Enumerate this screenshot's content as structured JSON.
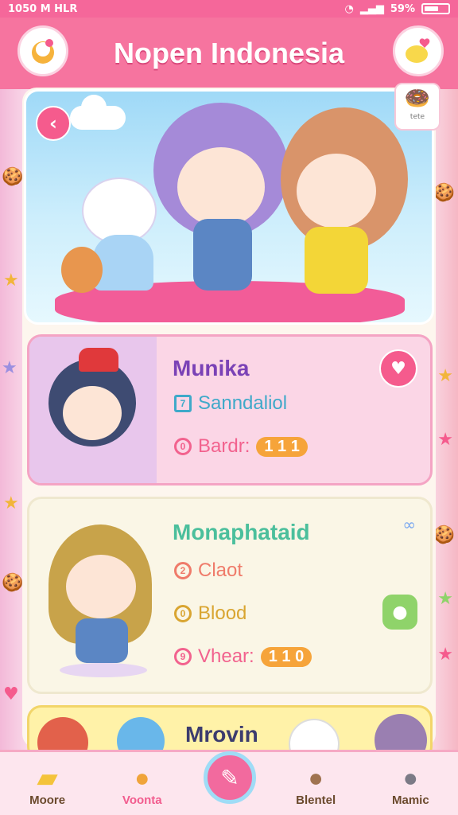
{
  "status_bar": {
    "time": "1050 M HLR",
    "battery": "59%"
  },
  "header": {
    "title": "Nopen Indonesia",
    "left_icon": "mascot-logo-icon",
    "right_icon": "chat-heart-icon"
  },
  "hero": {
    "back_icon": "chevron-left-icon",
    "badge_label": "tete"
  },
  "cards": [
    {
      "name": "Munika",
      "rows": [
        {
          "icon": "7",
          "label": "Sanndaliol",
          "color": "#3fa9c9"
        },
        {
          "icon": "0",
          "label": "Bardr:",
          "value": "1 1 1",
          "color": "#f2628e"
        }
      ]
    },
    {
      "name": "Monaphataid",
      "rows": [
        {
          "icon": "2",
          "label": "Claot",
          "color": "#ef7b6a"
        },
        {
          "icon": "0",
          "label": "Blood",
          "color": "#d9a531"
        },
        {
          "icon": "9",
          "label": "Vhear:",
          "value": "1 1 0",
          "color": "#f2628e"
        }
      ]
    },
    {
      "name": "Mrovin"
    }
  ],
  "nav": [
    {
      "label": "Moore",
      "color": "#6b4a2d"
    },
    {
      "label": "Voonta",
      "color": "#f25c8e"
    },
    {
      "label": "Blentel",
      "color": "#6b4a2d"
    },
    {
      "label": "Mamic",
      "color": "#6b4a2d"
    }
  ],
  "colors": {
    "accent": "#f6749f",
    "card1": "#fbd6e6",
    "card2": "#faf6e6",
    "card3": "#fff2a8"
  }
}
